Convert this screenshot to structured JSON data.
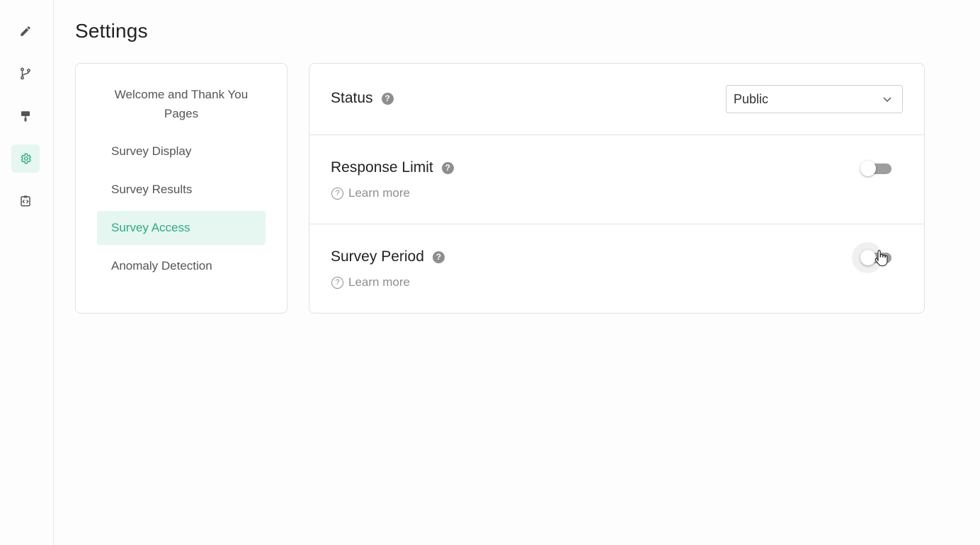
{
  "page": {
    "title": "Settings"
  },
  "rail": {
    "items": [
      {
        "icon": "pencil-icon",
        "active": false
      },
      {
        "icon": "branch-icon",
        "active": false
      },
      {
        "icon": "paint-roller-icon",
        "active": false
      },
      {
        "icon": "gear-icon",
        "active": true
      },
      {
        "icon": "code-clipboard-icon",
        "active": false
      }
    ],
    "accent": "#2faa84"
  },
  "nav": {
    "items": [
      {
        "label": "Welcome and Thank You Pages"
      },
      {
        "label": "Survey Display"
      },
      {
        "label": "Survey Results"
      },
      {
        "label": "Survey Access",
        "active": true
      },
      {
        "label": "Anomaly Detection"
      }
    ]
  },
  "settings": {
    "status": {
      "label": "Status",
      "help": "?",
      "value": "Public"
    },
    "response_limit": {
      "label": "Response Limit",
      "help": "?",
      "learn_more": "Learn more",
      "enabled": false
    },
    "survey_period": {
      "label": "Survey Period",
      "help": "?",
      "learn_more": "Learn more",
      "enabled": false
    }
  }
}
